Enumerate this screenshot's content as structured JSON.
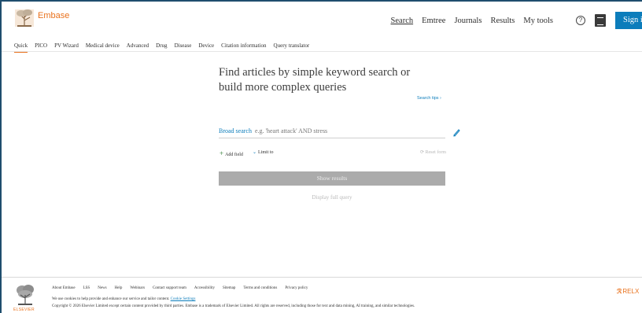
{
  "header": {
    "brand": "Embase",
    "nav": [
      {
        "label": "Search",
        "active": true
      },
      {
        "label": "Emtree",
        "active": false
      },
      {
        "label": "Journals",
        "active": false
      },
      {
        "label": "Results",
        "active": false
      },
      {
        "label": "My tools",
        "active": false
      }
    ],
    "help_icon": "question-circle-icon",
    "institution_icon": "institution-icon",
    "sign_in_label": "Sign in"
  },
  "subnav": [
    {
      "label": "Quick",
      "active": true
    },
    {
      "label": "PICO",
      "active": false
    },
    {
      "label": "PV Wizard",
      "active": false
    },
    {
      "label": "Medical device",
      "active": false
    },
    {
      "label": "Advanced",
      "active": false
    },
    {
      "label": "Drug",
      "active": false
    },
    {
      "label": "Disease",
      "active": false
    },
    {
      "label": "Device",
      "active": false
    },
    {
      "label": "Citation information",
      "active": false
    },
    {
      "label": "Query translator",
      "active": false
    }
  ],
  "main": {
    "headline": "Find articles by simple keyword search or build more complex queries",
    "search_tips": "Search tips ›",
    "field_label": "Broad search",
    "search_placeholder": "e.g. 'heart attack' AND stress",
    "add_field": "Add field",
    "limit_to": "Limit to",
    "reset_form": "Reset form",
    "show_results": "Show results",
    "display_full_query": "Display full query"
  },
  "footer": {
    "links": [
      "About Embase",
      "LSS",
      "News",
      "Help",
      "Webinars",
      "Contact support team",
      "Accessibility",
      "Sitemap",
      "Terms and conditions",
      "Privacy policy"
    ],
    "cookie_text": "We use cookies to help provide and enhance our service and tailor content.",
    "cookie_link": "Cookie Settings",
    "copyright": "Copyright © 2026 Elsevier Limited except certain content provided by third parties. Embase is a trademark of Elsevier Limited. All rights are reserved, including those for text and data mining, AI training, and similar technologies.",
    "elsevier": "ELSEVIER",
    "relx": "RELX"
  },
  "colors": {
    "accent": "#e9711c",
    "link": "#0c7dbb",
    "button_disabled": "#ababab"
  }
}
